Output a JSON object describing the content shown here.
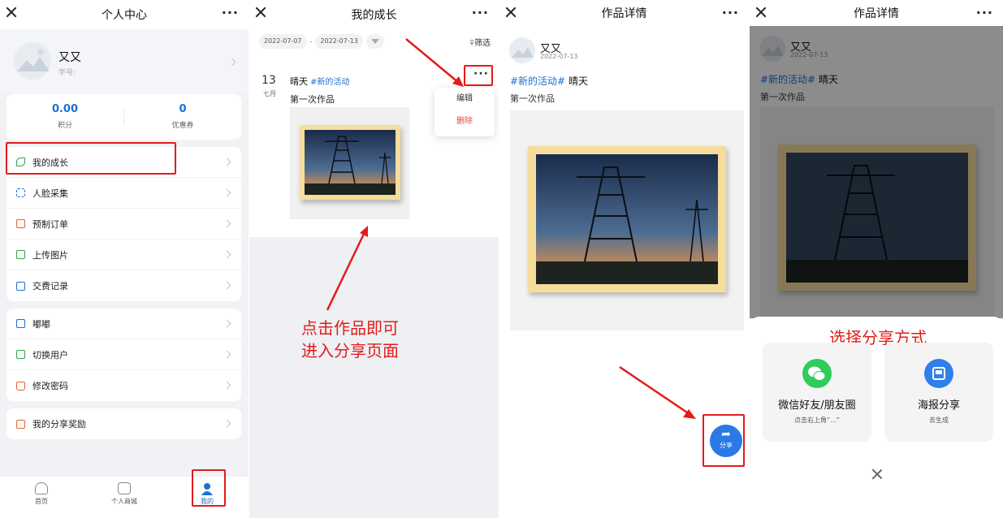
{
  "panel1": {
    "title": "个人中心",
    "user": {
      "name": "又又",
      "student_id_label": "学号:"
    },
    "stats": [
      {
        "value": "0.00",
        "label": "积分"
      },
      {
        "value": "0",
        "label": "优惠券"
      }
    ],
    "menu_group1": [
      {
        "label": "我的成长",
        "icon": "sprout-icon"
      },
      {
        "label": "人脸采集",
        "icon": "face-scan-icon"
      },
      {
        "label": "预制订单",
        "icon": "order-icon"
      },
      {
        "label": "上传图片",
        "icon": "image-icon"
      },
      {
        "label": "交费记录",
        "icon": "record-icon"
      }
    ],
    "menu_group2": [
      {
        "label": "嘟嘟",
        "icon": "mail-icon"
      },
      {
        "label": "切换用户",
        "icon": "switch-user-icon"
      },
      {
        "label": "修改密码",
        "icon": "lock-icon"
      }
    ],
    "menu_group3": [
      {
        "label": "我的分享奖励",
        "icon": "gift-icon"
      }
    ],
    "tabs": [
      {
        "label": "首页",
        "icon": "home-icon"
      },
      {
        "label": "个人商城",
        "icon": "shop-icon"
      },
      {
        "label": "我的",
        "icon": "person-icon"
      }
    ]
  },
  "panel2": {
    "title": "我的成长",
    "start_date": "2022-07-07",
    "date_sep": "-",
    "end_date": "2022-07-13",
    "filter_label": "筛选",
    "entry": {
      "day": "13",
      "month": "七月",
      "weather": "晴天",
      "tag": "#新的活动",
      "title": "第一次作品"
    },
    "menu": {
      "edit": "编辑",
      "delete": "删除"
    },
    "annotation_line1": "点击作品即可",
    "annotation_line2": "进入分享页面"
  },
  "panel3": {
    "title": "作品详情",
    "user_name": "又又",
    "date": "2022-07-13",
    "tag": "#新的活动#",
    "weather": "晴天",
    "subtitle": "第一次作品",
    "share_label": "分享"
  },
  "panel4": {
    "title": "作品详情",
    "user_name": "又又",
    "date": "2022-07-13",
    "tag": "#新的活动#",
    "weather": "晴天",
    "subtitle": "第一次作品",
    "annotation": "选择分享方式",
    "options": [
      {
        "name": "微信好友/朋友圈",
        "sub": "点击右上角“...”",
        "icon": "wechat-icon",
        "color": "#2ecc5b"
      },
      {
        "name": "海报分享",
        "sub": "去生成",
        "icon": "poster-icon",
        "color": "#2f80ed"
      }
    ]
  },
  "colors": {
    "accent": "#1e6fd0",
    "annotation_red": "#e31b1b",
    "frame": "#f6dd9c"
  }
}
